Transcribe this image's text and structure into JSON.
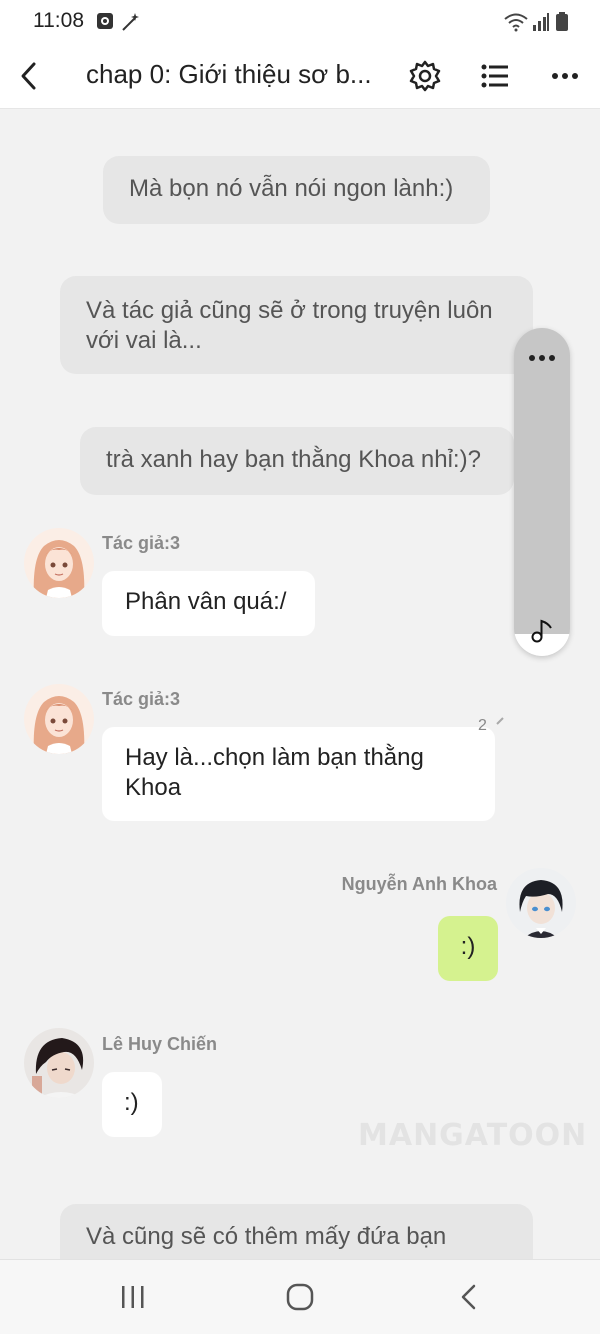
{
  "status_bar": {
    "time": "11:08",
    "left_icons": [
      "app-notification-icon",
      "magic-wand-icon"
    ],
    "right_icons": [
      "wifi-icon",
      "signal-icon",
      "battery-icon"
    ]
  },
  "header": {
    "title": "chap 0: Giới thiệu sơ b...",
    "buttons": [
      "back-arrow-icon",
      "settings-icon",
      "list-icon",
      "more-icon"
    ]
  },
  "messages": {
    "n1": "Mà bọn nó vẫn nói ngon lành:)",
    "n2": "Và tác giả cũng sẽ ở trong truyện luôn với vai là...",
    "n3": "trà xanh hay bạn thằng Khoa nhỉ:)?",
    "m1": {
      "sender": "Tác giả:3",
      "text": "Phân vân quá:/"
    },
    "m2": {
      "sender": "Tác giả:3",
      "text": "Hay là...chọn làm bạn thằng Khoa",
      "comment_count": "2"
    },
    "m3": {
      "sender": "Nguyễn Anh Khoa",
      "text": ":)"
    },
    "m4": {
      "sender": "Lê Huy Chiến",
      "text": ":)"
    },
    "n4": "Và cũng sẽ có thêm mấy đứa bạn"
  },
  "watermark": "MANGATOON",
  "colors": {
    "background": "#f2f2f2",
    "narration_bubble": "#e6e6e6",
    "chat_bubble": "#ffffff",
    "my_bubble": "#d5f28f",
    "name_text": "#8a8a8a"
  }
}
